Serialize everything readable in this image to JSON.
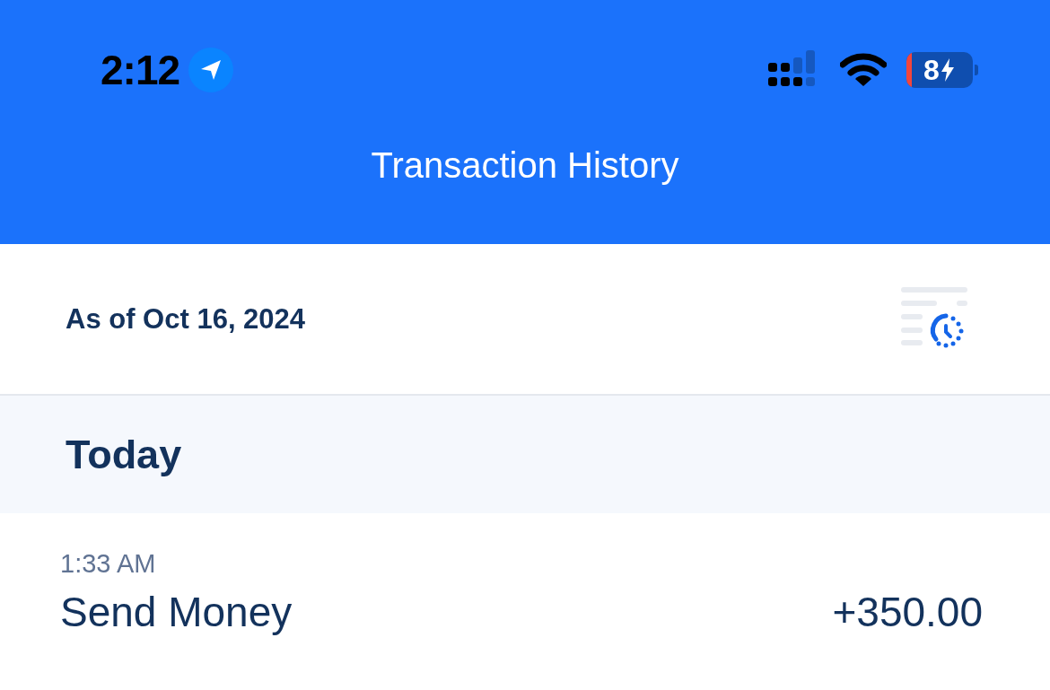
{
  "status_bar": {
    "time": "2:12",
    "battery": "8"
  },
  "header": {
    "title": "Transaction History"
  },
  "as_of": "As of Oct 16, 2024",
  "sections": [
    {
      "title": "Today",
      "transactions": [
        {
          "time": "1:33 AM",
          "name": "Send Money",
          "amount": "+350.00"
        }
      ]
    }
  ]
}
